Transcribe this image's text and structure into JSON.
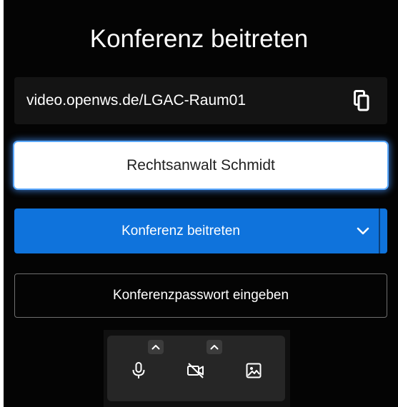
{
  "dialog": {
    "title": "Konferenz beitreten"
  },
  "meeting_url": {
    "text": "video.openws.de/LGAC-Raum01",
    "copy_icon": "copy-icon"
  },
  "name_input": {
    "value": "Rechtsanwalt Schmidt"
  },
  "join_button": {
    "label": "Konferenz beitreten",
    "dropdown_icon": "chevron-down-icon"
  },
  "password_button": {
    "label": "Konferenzpasswort eingeben"
  },
  "toolbar": {
    "buttons": [
      {
        "icon": "microphone-icon"
      },
      {
        "icon": "camera-off-icon"
      },
      {
        "icon": "background-image-icon"
      }
    ]
  },
  "colors": {
    "background": "#040404",
    "accent": "#0f73dc",
    "focus_glow": "#5aa8ff"
  }
}
